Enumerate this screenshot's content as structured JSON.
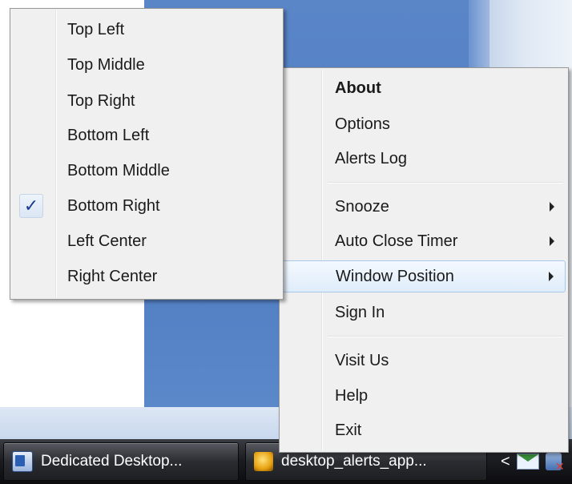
{
  "main_menu": {
    "items": [
      {
        "label": "About",
        "bold": true
      },
      {
        "label": "Options"
      },
      {
        "label": "Alerts Log"
      },
      {
        "label": "Snooze",
        "submenu": true
      },
      {
        "label": "Auto Close Timer",
        "submenu": true
      },
      {
        "label": "Window Position",
        "submenu": true,
        "highlighted": true
      },
      {
        "label": "Sign In"
      },
      {
        "label": "Visit Us"
      },
      {
        "label": "Help"
      },
      {
        "label": "Exit"
      }
    ]
  },
  "position_submenu": {
    "items": [
      {
        "label": "Top Left"
      },
      {
        "label": "Top Middle"
      },
      {
        "label": "Top Right"
      },
      {
        "label": "Bottom Left"
      },
      {
        "label": "Bottom Middle"
      },
      {
        "label": "Bottom Right",
        "checked": true
      },
      {
        "label": "Left Center"
      },
      {
        "label": "Right Center"
      }
    ],
    "check_glyph": "✓"
  },
  "taskbar": {
    "buttons": [
      {
        "label": "Dedicated Desktop...",
        "icon": "word-document-icon"
      },
      {
        "label": "desktop_alerts_app...",
        "icon": "desktop-alerts-icon"
      }
    ],
    "tray": {
      "chevron": "<",
      "icons": [
        "mail-icon",
        "network-disconnected-icon"
      ]
    }
  }
}
